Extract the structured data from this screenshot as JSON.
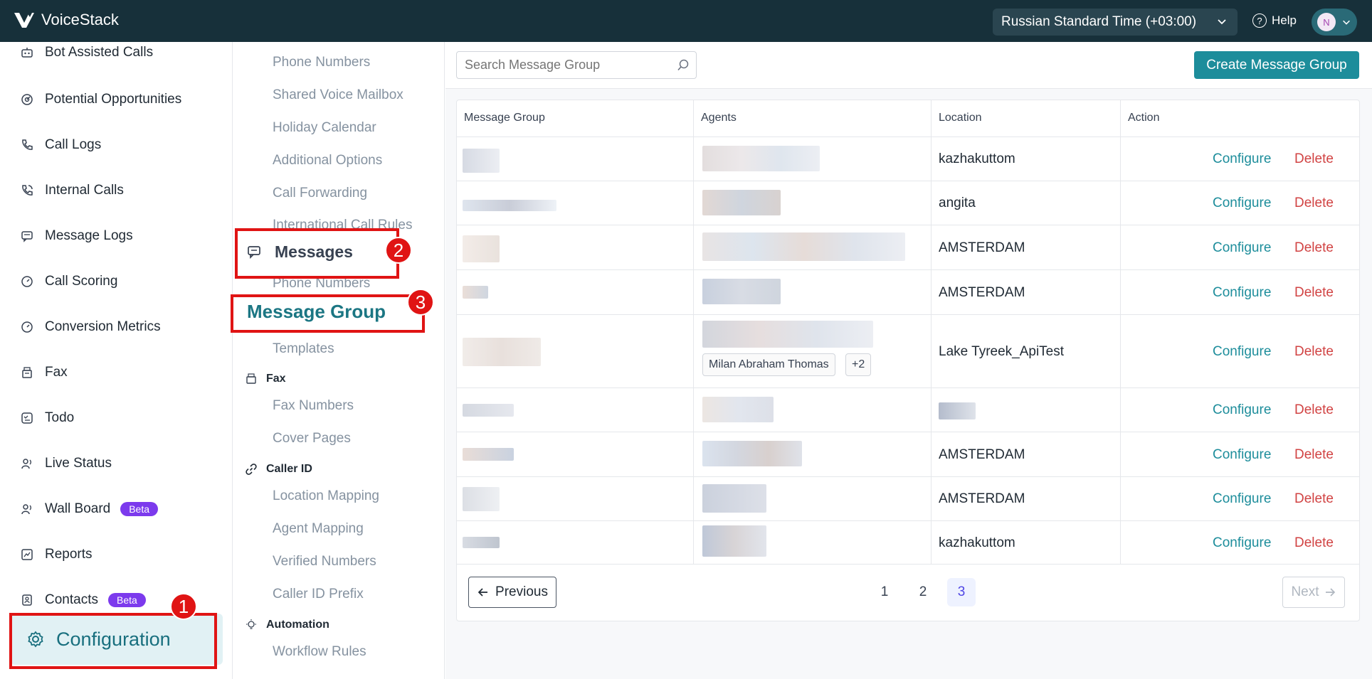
{
  "app": {
    "name": "VoiceStack"
  },
  "header": {
    "timezone": "Russian Standard Time (+03:00)",
    "help_label": "Help",
    "avatar_initial": "N"
  },
  "sidebar": {
    "items": [
      {
        "label": "Bot Assisted Calls",
        "icon": "robot-icon"
      },
      {
        "label": "Potential Opportunities",
        "icon": "opportunity-icon"
      },
      {
        "label": "Call Logs",
        "icon": "phone-icon"
      },
      {
        "label": "Internal Calls",
        "icon": "phone-internal-icon"
      },
      {
        "label": "Message Logs",
        "icon": "message-icon"
      },
      {
        "label": "Call Scoring",
        "icon": "gauge-icon"
      },
      {
        "label": "Conversion Metrics",
        "icon": "gauge-icon"
      },
      {
        "label": "Fax",
        "icon": "fax-icon"
      },
      {
        "label": "Todo",
        "icon": "todo-icon"
      },
      {
        "label": "Live Status",
        "icon": "live-status-icon"
      },
      {
        "label": "Wall Board",
        "icon": "wallboard-icon",
        "badge": "Beta"
      },
      {
        "label": "Reports",
        "icon": "reports-icon"
      },
      {
        "label": "Contacts",
        "icon": "contacts-icon",
        "badge": "Beta"
      }
    ],
    "active": {
      "label": "Configuration",
      "icon": "gear-icon"
    }
  },
  "submenu": {
    "phone_items": [
      "Phone Numbers",
      "Shared Voice Mailbox",
      "Holiday Calendar",
      "Additional Options",
      "Call Forwarding",
      "International Call Rules"
    ],
    "messages_title": "Messages",
    "messages_items": [
      "Phone Numbers",
      "Message Group",
      "Templates"
    ],
    "fax_title": "Fax",
    "fax_items": [
      "Fax Numbers",
      "Cover Pages"
    ],
    "caller_id_title": "Caller ID",
    "caller_id_items": [
      "Location Mapping",
      "Agent Mapping",
      "Verified Numbers",
      "Caller ID Prefix"
    ],
    "automation_title": "Automation",
    "automation_items": [
      "Workflow Rules"
    ]
  },
  "annotations": {
    "one": "1",
    "two": "2",
    "three": "3"
  },
  "main": {
    "search_placeholder": "Search Message Group",
    "create_label": "Create Message Group",
    "columns": [
      "Message Group",
      "Agents",
      "Location",
      "Action"
    ],
    "rows": [
      {
        "location": "kazhakuttom"
      },
      {
        "location": "angita"
      },
      {
        "location": "AMSTERDAM"
      },
      {
        "location": "AMSTERDAM"
      },
      {
        "location": "Lake Tyreek_ApiTest",
        "agent_chip": "Milan Abraham Thomas",
        "more_chip": "+2"
      },
      {
        "location": ""
      },
      {
        "location": "AMSTERDAM"
      },
      {
        "location": "AMSTERDAM"
      },
      {
        "location": "kazhakuttom"
      }
    ],
    "configure_label": "Configure",
    "delete_label": "Delete",
    "pagination": {
      "previous": "Previous",
      "next": "Next",
      "pages": [
        "1",
        "2",
        "3"
      ],
      "current": "3"
    }
  }
}
